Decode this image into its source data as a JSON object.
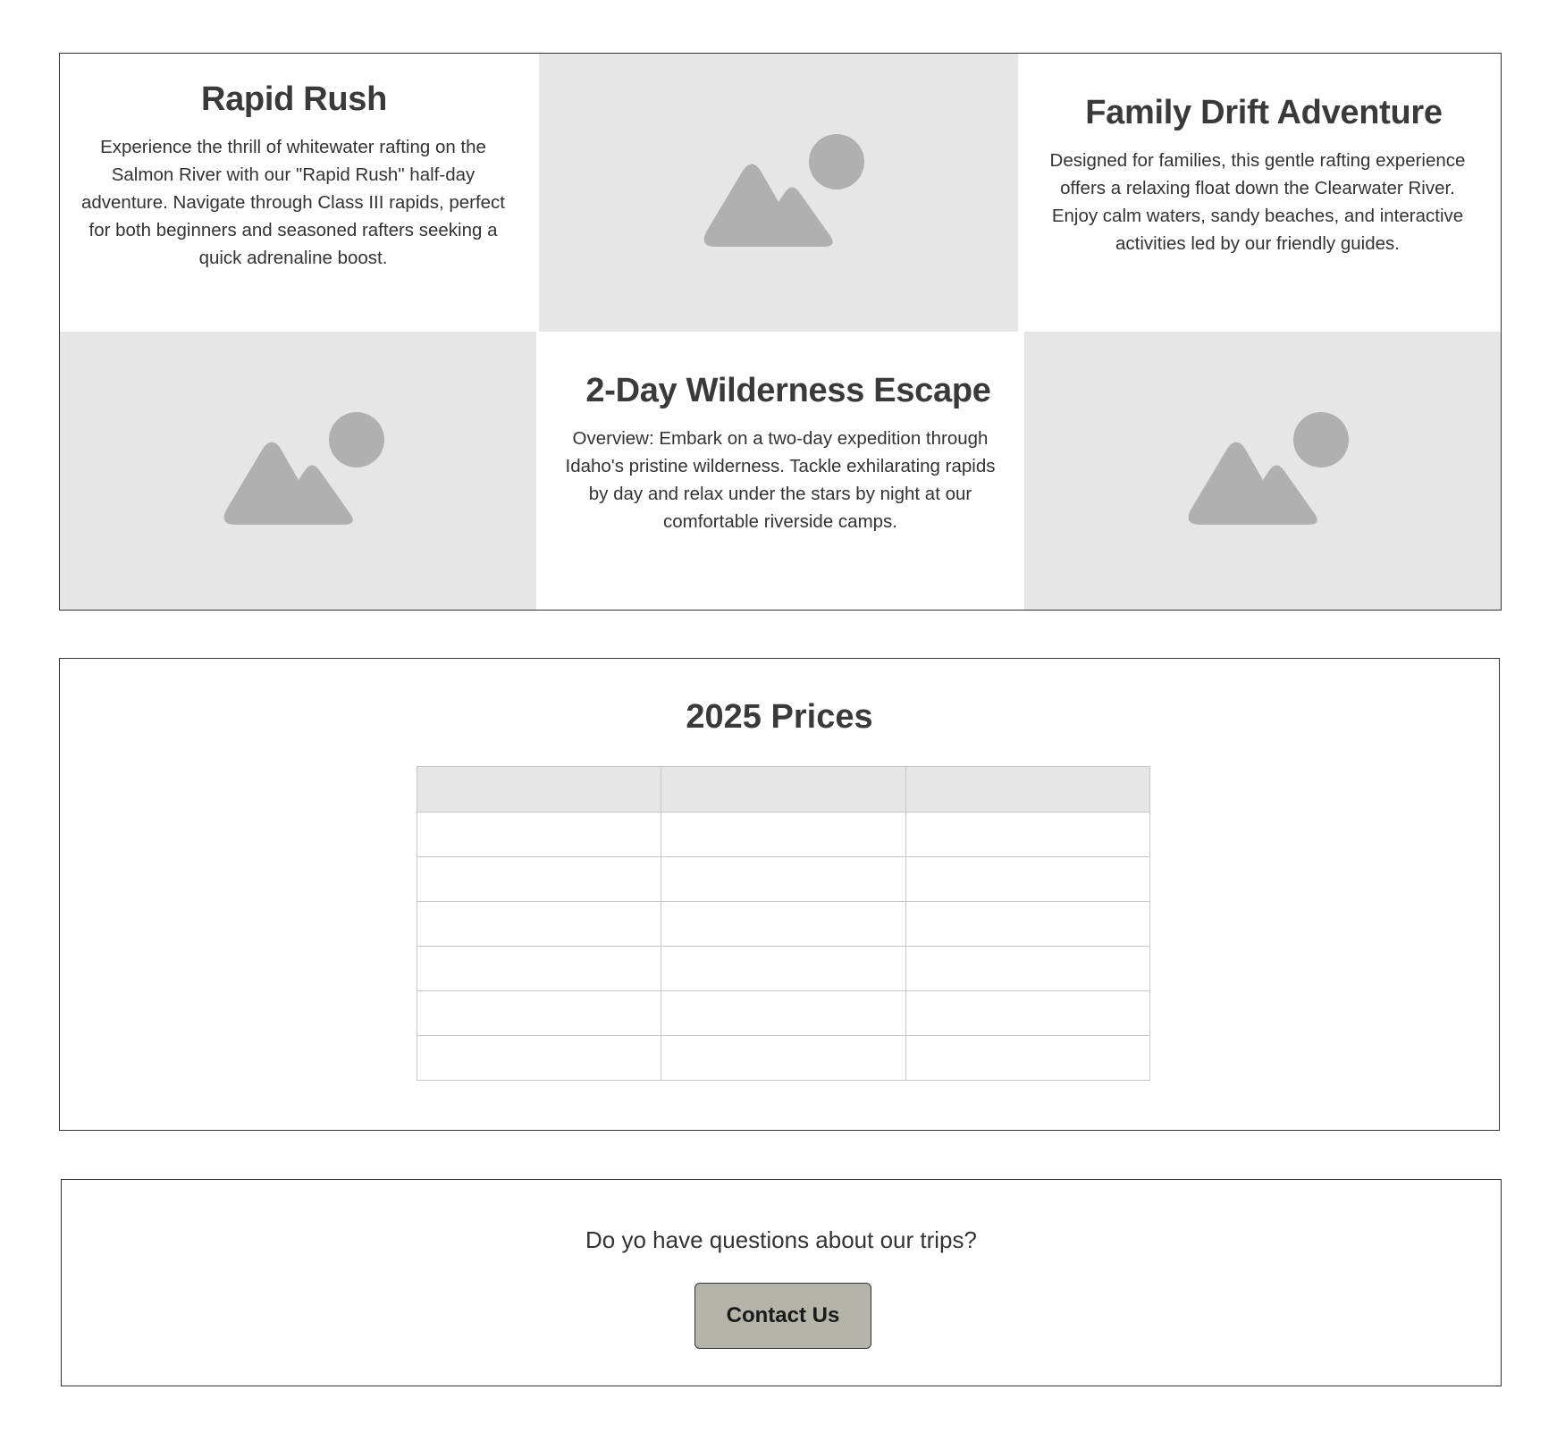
{
  "trips": {
    "rapid_rush": {
      "title": "Rapid Rush",
      "description": "Experience the thrill of whitewater rafting on the Salmon River with our \"Rapid Rush\" half-day adventure. Navigate through Class III rapids, perfect for both beginners and seasoned rafters seeking a quick adrenaline boost."
    },
    "family_drift": {
      "title": "Family Drift Adventure",
      "description": "Designed for families, this gentle rafting experience offers a relaxing float down the Clearwater River. Enjoy calm waters, sandy beaches, and interactive activities led by our friendly guides."
    },
    "wilderness_escape": {
      "title": "2-Day Wilderness Escape",
      "description": "Overview: Embark on a two-day expedition through Idaho's pristine wilderness. Tackle exhilarating rapids by day and relax under the stars by night at our comfortable riverside camps."
    },
    "image_icon": "image-placeholder-icon"
  },
  "prices": {
    "title": "2025 Prices",
    "headers": [
      "",
      "",
      ""
    ],
    "rows": [
      [
        "",
        "",
        ""
      ],
      [
        "",
        "",
        ""
      ],
      [
        "",
        "",
        ""
      ],
      [
        "",
        "",
        ""
      ],
      [
        "",
        "",
        ""
      ],
      [
        "",
        "",
        ""
      ]
    ]
  },
  "contact": {
    "question": "Do yo have questions about our trips?",
    "button_label": "Contact Us"
  },
  "colors": {
    "placeholder_bg": "#e6e6e6",
    "placeholder_icon": "#b0b0b0",
    "button_bg": "#b4b4aa",
    "border": "#333333"
  }
}
